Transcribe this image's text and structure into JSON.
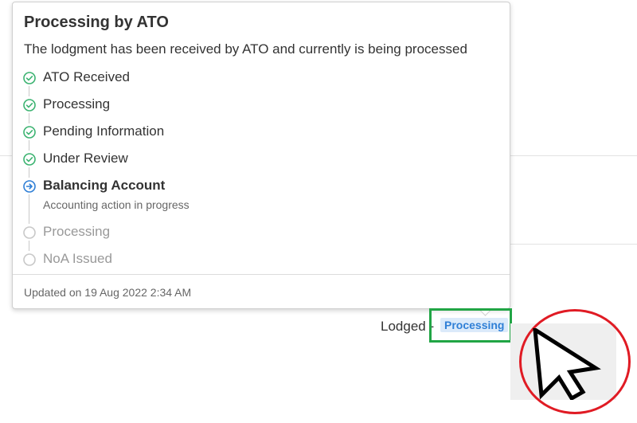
{
  "popover": {
    "title": "Processing by ATO",
    "description": "The lodgment has been received by ATO and currently is being processed",
    "steps": [
      {
        "label": "ATO Received",
        "state": "done"
      },
      {
        "label": "Processing",
        "state": "done"
      },
      {
        "label": "Pending Information",
        "state": "done"
      },
      {
        "label": "Under Review",
        "state": "done"
      },
      {
        "label": "Balancing Account",
        "state": "active",
        "sublabel": "Accounting action in progress"
      },
      {
        "label": "Processing",
        "state": "pending"
      },
      {
        "label": "NoA Issued",
        "state": "pending"
      }
    ],
    "footer": "Updated on 19 Aug 2022 2:34 AM"
  },
  "status": {
    "label": "Lodged -",
    "badge": "Processing"
  },
  "colors": {
    "done": "#3cb371",
    "active": "#2f7fd6",
    "pending": "#c8c8c8",
    "highlight": "#21a545",
    "cursor_circle": "#e01b24"
  },
  "icons": {
    "done": "check-circle-icon",
    "active": "arrow-right-circle-icon",
    "pending": "empty-circle-icon",
    "cursor": "mouse-pointer-icon"
  }
}
